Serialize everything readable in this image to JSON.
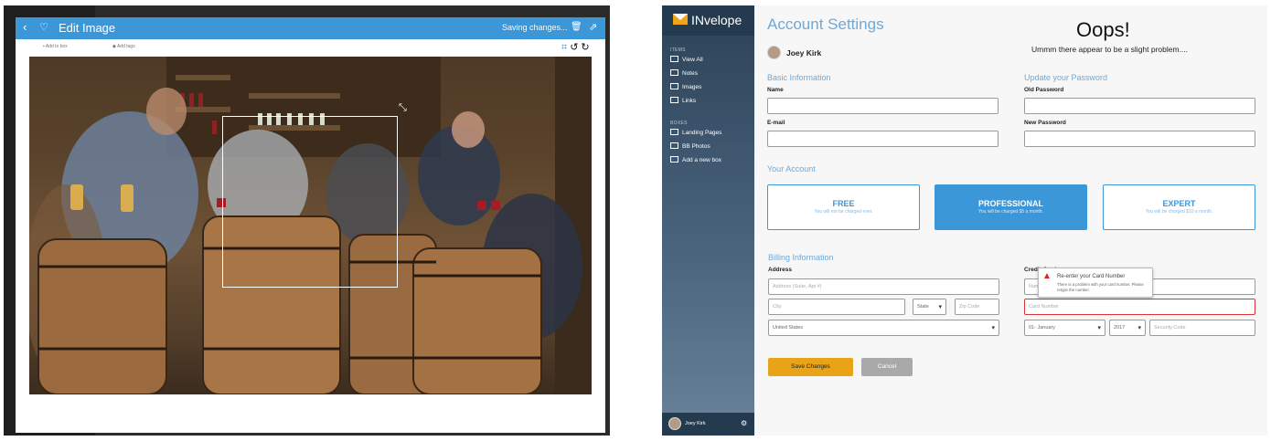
{
  "editor": {
    "header": {
      "back_icon": "chevron-left-icon",
      "favorite_icon": "heart-icon",
      "title": "Edit Image",
      "status": "Saving changes...",
      "delete_icon": "trash-icon",
      "share_icon": "share-icon"
    },
    "subbar": {
      "add_to_box": "Add to box",
      "add_tags": "Add tags",
      "tools": [
        "crop-icon",
        "rotate-left-icon",
        "rotate-right-icon"
      ]
    }
  },
  "app": {
    "brand": "INvelope",
    "sidebar": {
      "items_heading": "ITEMS",
      "items": [
        {
          "label": "View All",
          "icon": "grid-icon"
        },
        {
          "label": "Notes",
          "icon": "note-icon"
        },
        {
          "label": "Images",
          "icon": "image-icon"
        },
        {
          "label": "Links",
          "icon": "link-icon"
        }
      ],
      "boxes_heading": "BOXES",
      "boxes": [
        {
          "label": "Landing Pages",
          "icon": "inbox-icon"
        },
        {
          "label": "BB Photos",
          "icon": "inbox-icon"
        },
        {
          "label": "Add a new box",
          "icon": "plus-box-icon"
        }
      ],
      "user_name": "Joey Kirk",
      "settings_icon": "gear-icon"
    },
    "main": {
      "title": "Account Settings",
      "user_name": "Joey Kirk",
      "error_title": "Oops!",
      "error_message": "Ummm there appear to be a slight problem....",
      "basic": {
        "heading": "Basic Information",
        "name_label": "Name",
        "email_label": "E-mail"
      },
      "password": {
        "heading": "Update your Password",
        "old_label": "Old Password",
        "new_label": "New Password"
      },
      "account": {
        "heading": "Your Account",
        "plans": [
          {
            "name": "FREE",
            "desc": "You will not be charged ever."
          },
          {
            "name": "PROFESSIONAL",
            "desc": "You will be charged $5 a month.",
            "selected": true
          },
          {
            "name": "EXPERT",
            "desc": "You will be charged $10 a month."
          }
        ]
      },
      "billing": {
        "heading": "Billing Information",
        "address_label": "Address",
        "address_placeholder": "Address (Suite, Apt #)",
        "city_placeholder": "City",
        "state_value": "State",
        "zip_placeholder": "Zip Code",
        "country_value": "United States",
        "card_label": "Credit Card",
        "name_placeholder": "Name on Card",
        "card_placeholder": "Card Number",
        "month_value": "01- January",
        "year_value": "2017",
        "security_placeholder": "Security Code"
      },
      "tooltip": {
        "title": "Re-enter your Card Number",
        "message": "There is a problem with your card number. Please retype the number."
      },
      "save_label": "Save Changes",
      "cancel_label": "Cancel"
    },
    "colors": {
      "accent": "#3c97d9",
      "save": "#e8a317",
      "cancel": "#a9a9a9",
      "error": "#d33333"
    }
  }
}
